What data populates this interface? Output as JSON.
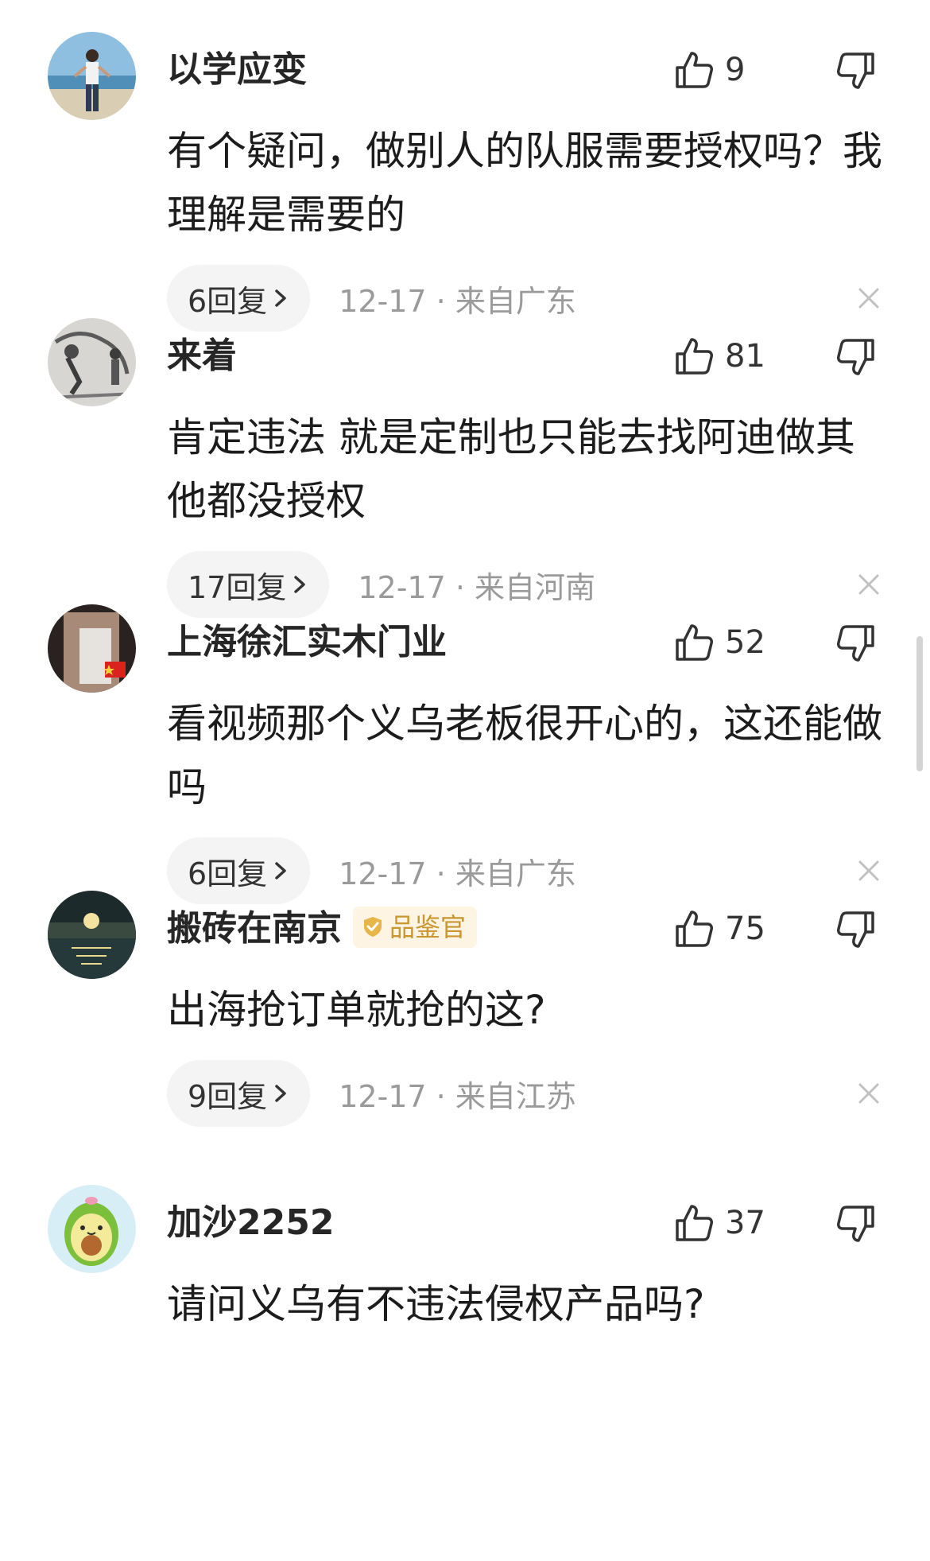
{
  "comments": [
    {
      "username": "以学应变",
      "badge": "",
      "likes": "9",
      "text": "有个疑问，做别人的队服需要授权吗？我理解是需要的",
      "replies": "6回复",
      "meta": "12-17 · 来自广东",
      "avatar": "beach-man-avatar"
    },
    {
      "username": "来着",
      "badge": "",
      "likes": "81",
      "text": "肯定违法 就是定制也只能去找阿迪做其他都没授权",
      "replies": "17回复",
      "meta": "12-17 · 来自河南",
      "avatar": "sketch-avatar"
    },
    {
      "username": "上海徐汇实木门业",
      "badge": "",
      "likes": "52",
      "text": "看视频那个义乌老板很开心的，这还能做吗",
      "replies": "6回复",
      "meta": "12-17 · 来自广东",
      "avatar": "person-flag-avatar"
    },
    {
      "username": "搬砖在南京",
      "badge": "品鉴官",
      "likes": "75",
      "text": "出海抢订单就抢的这?",
      "replies": "9回复",
      "meta": "12-17 · 来自江苏",
      "avatar": "moon-lake-avatar"
    },
    {
      "username": "加沙2252",
      "badge": "",
      "likes": "37",
      "text": "请问义乌有不违法侵权产品吗?",
      "replies": "",
      "meta": "",
      "avatar": "avocado-avatar"
    }
  ],
  "colors": {
    "meta_gray": "#9a9a9a",
    "pill_bg": "#f4f4f4",
    "badge_bg": "#fdf4e3",
    "badge_text": "#c9962f"
  }
}
